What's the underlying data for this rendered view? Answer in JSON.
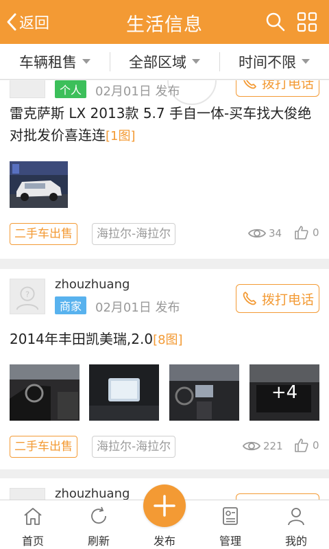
{
  "header": {
    "back_label": "返回",
    "title": "生活信息"
  },
  "filters": [
    {
      "label": "车辆租售"
    },
    {
      "label": "全部区域"
    },
    {
      "label": "时间不限"
    }
  ],
  "posts": [
    {
      "badge": "个人",
      "date": "02月01日 发布",
      "call_label": "拨打电话",
      "title": "雷克萨斯 LX 2013款 5.7 手自一体-买车找大俊绝对批发价喜连连",
      "image_count": "[1图]",
      "category_tag": "二手车出售",
      "location_tag": "海拉尔-海拉尔",
      "views": "34",
      "likes": "0"
    },
    {
      "username": "zhouzhuang",
      "badge": "商家",
      "date": "02月01日 发布",
      "call_label": "拨打电话",
      "title": "2014年丰田凯美瑞,2.0",
      "image_count": "[8图]",
      "more_images": "+4",
      "category_tag": "二手车出售",
      "location_tag": "海拉尔-海拉尔",
      "views": "221",
      "likes": "0"
    },
    {
      "username": "zhouzhuang"
    }
  ],
  "tabbar": {
    "home": "首页",
    "refresh": "刷新",
    "publish": "发布",
    "manage": "管理",
    "mine": "我的"
  },
  "colors": {
    "accent": "#f39a34",
    "merchant_badge": "#58b2ee",
    "personal_badge": "#3cbf5a"
  }
}
